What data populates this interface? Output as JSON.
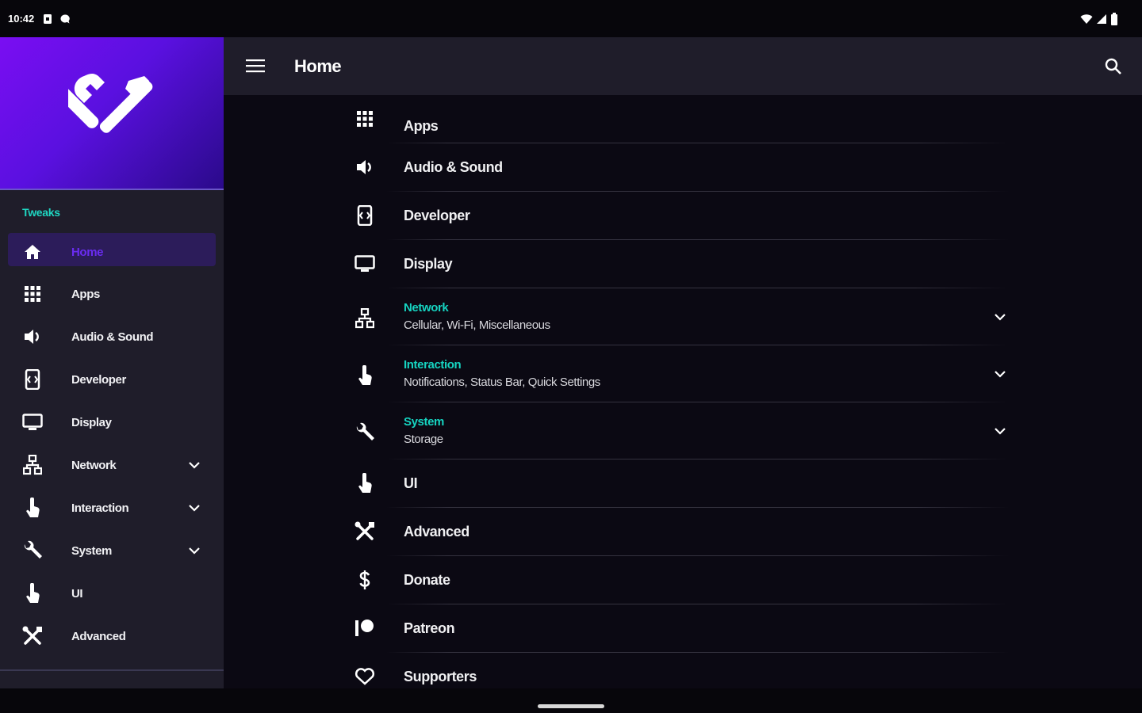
{
  "status_bar": {
    "time": "10:42",
    "left_icons": [
      "sim-icon",
      "chat-icon"
    ],
    "right_icons": [
      "wifi-icon",
      "signal-icon",
      "battery-icon"
    ]
  },
  "app": {
    "title": "Home",
    "accent": "#7a0ef2",
    "teal": "#16d4c1"
  },
  "drawer": {
    "section_title": "Tweaks",
    "items": [
      {
        "label": "Home",
        "icon": "home-icon",
        "active": true,
        "expandable": false
      },
      {
        "label": "Apps",
        "icon": "apps-grid-icon",
        "active": false,
        "expandable": false
      },
      {
        "label": "Audio & Sound",
        "icon": "speaker-icon",
        "active": false,
        "expandable": false
      },
      {
        "label": "Developer",
        "icon": "developer-icon",
        "active": false,
        "expandable": false
      },
      {
        "label": "Display",
        "icon": "monitor-icon",
        "active": false,
        "expandable": false
      },
      {
        "label": "Network",
        "icon": "network-icon",
        "active": false,
        "expandable": true
      },
      {
        "label": "Interaction",
        "icon": "touch-icon",
        "active": false,
        "expandable": true
      },
      {
        "label": "System",
        "icon": "wrench-icon",
        "active": false,
        "expandable": true
      },
      {
        "label": "UI",
        "icon": "touch-icon",
        "active": false,
        "expandable": false
      },
      {
        "label": "Advanced",
        "icon": "tools-icon",
        "active": false,
        "expandable": false
      }
    ]
  },
  "main": {
    "rows": [
      {
        "label": "Apps",
        "icon": "apps-grid-icon"
      },
      {
        "label": "Audio & Sound",
        "icon": "speaker-icon"
      },
      {
        "label": "Developer",
        "icon": "developer-icon"
      },
      {
        "label": "Display",
        "icon": "monitor-icon"
      },
      {
        "title": "Network",
        "subtitle": "Cellular, Wi-Fi, Miscellaneous",
        "icon": "network-icon",
        "expandable": true
      },
      {
        "title": "Interaction",
        "subtitle": "Notifications, Status Bar, Quick Settings",
        "icon": "touch-icon",
        "expandable": true
      },
      {
        "title": "System",
        "subtitle": "Storage",
        "icon": "wrench-icon",
        "expandable": true
      },
      {
        "label": "UI",
        "icon": "touch-icon"
      },
      {
        "label": "Advanced",
        "icon": "tools-icon"
      },
      {
        "label": "Donate",
        "icon": "dollar-icon"
      },
      {
        "label": "Patreon",
        "icon": "patreon-icon"
      },
      {
        "label": "Supporters",
        "icon": "heart-icon"
      }
    ]
  }
}
